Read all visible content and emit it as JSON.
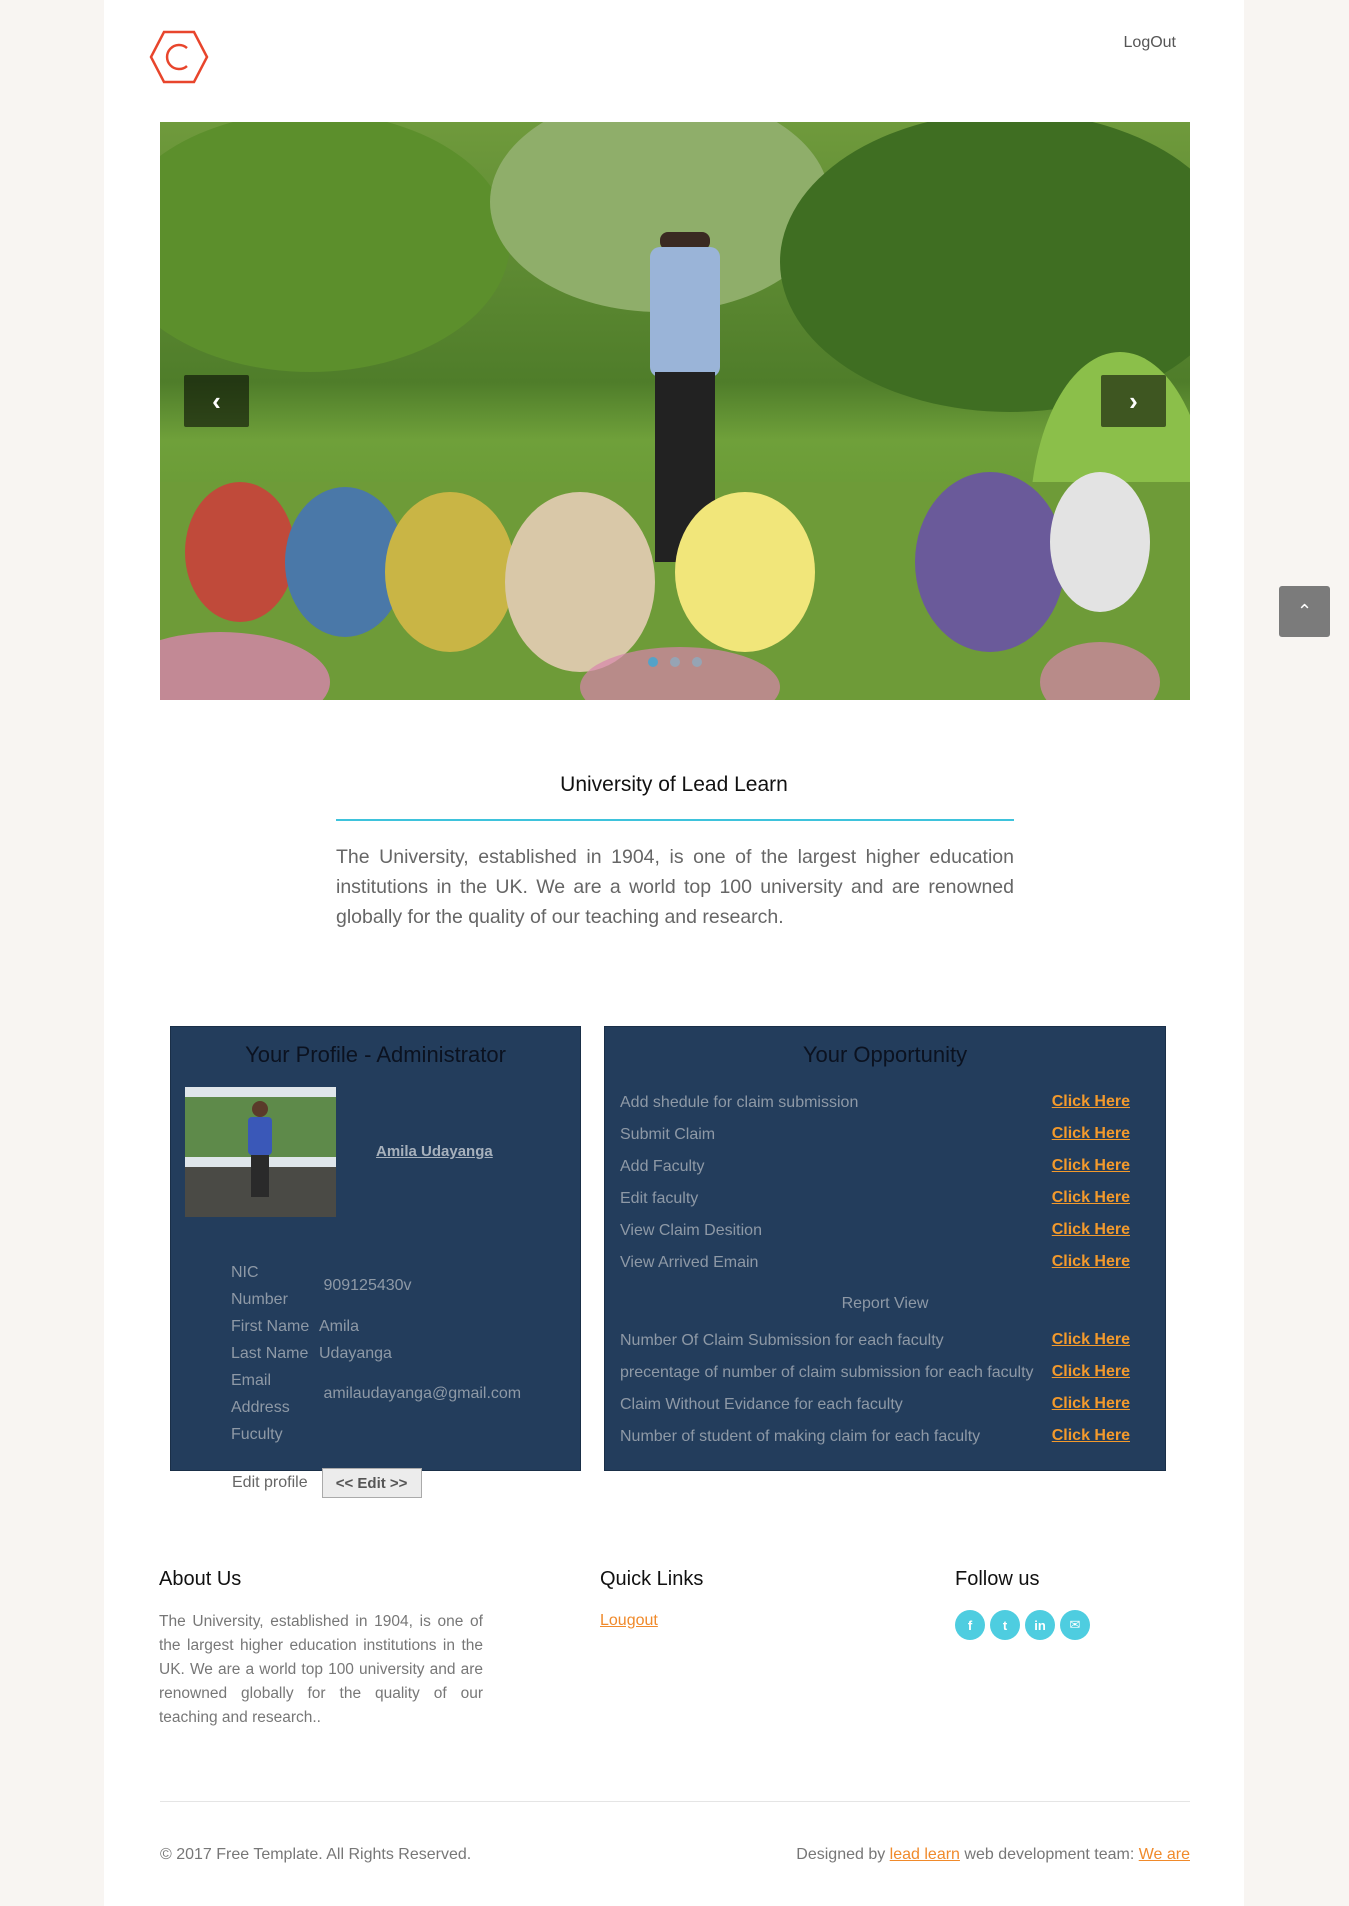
{
  "header": {
    "logout_label": "LogOut"
  },
  "hero": {
    "dots": 3,
    "active_dot": 0
  },
  "intro": {
    "title": "University of Lead Learn",
    "text": "The University, established in 1904, is one of the largest higher education institutions in the UK. We are a world top 100 university and are renowned globally for the quality of our teaching and research."
  },
  "profile": {
    "title": "Your Profile - Administrator",
    "name": "Amila Udayanga",
    "fields": [
      {
        "key": "NIC Number",
        "value": "909125430v"
      },
      {
        "key": "First Name",
        "value": "Amila"
      },
      {
        "key": "Last Name",
        "value": "Udayanga"
      },
      {
        "key": "Email Address",
        "value": "amilaudayanga@gmail.com"
      },
      {
        "key": "Fuculty",
        "value": ""
      }
    ],
    "edit_label": "Edit profile",
    "edit_button": "<<  Edit  >>"
  },
  "opportunity": {
    "title": "Your Opportunity",
    "items": [
      {
        "label": "Add shedule for claim submission",
        "link": "Click Here"
      },
      {
        "label": "Submit Claim",
        "link": "Click Here"
      },
      {
        "label": "Add Faculty",
        "link": "Click Here"
      },
      {
        "label": "Edit faculty",
        "link": "Click Here"
      },
      {
        "label": "View Claim Desition",
        "link": "Click Here"
      },
      {
        "label": "View Arrived Emain",
        "link": "Click Here"
      }
    ],
    "report_view": "Report View",
    "reports": [
      {
        "label": "Number Of Claim Submission for each faculty",
        "link": "Click Here"
      },
      {
        "label": "precentage of number of claim submission for each faculty",
        "link": "Click Here"
      },
      {
        "label": "Claim Without Evidance for each faculty",
        "link": "Click Here"
      },
      {
        "label": "Number of student of making claim for each faculty",
        "link": "Click Here"
      }
    ]
  },
  "footer": {
    "about_title": "About Us",
    "about_text": "The University, established in 1904, is one of the largest higher education institutions in the UK. We are a world top 100 university and are renowned globally for the quality of our teaching and research..",
    "quick_title": "Quick Links",
    "quick_link": "Lougout",
    "follow_title": "Follow us",
    "socials": [
      "f",
      "t",
      "in",
      "✉"
    ],
    "copyright": "© 2017 Free Template. All Rights Reserved.",
    "credits_prefix": "Designed by ",
    "credits_link1": "lead learn",
    "credits_mid": " web development team: ",
    "credits_link2": "We are"
  },
  "colors": {
    "accent": "#3ec3dc",
    "panel": "#233d5c",
    "link": "#f39a2c",
    "logo": "#e8452c"
  }
}
